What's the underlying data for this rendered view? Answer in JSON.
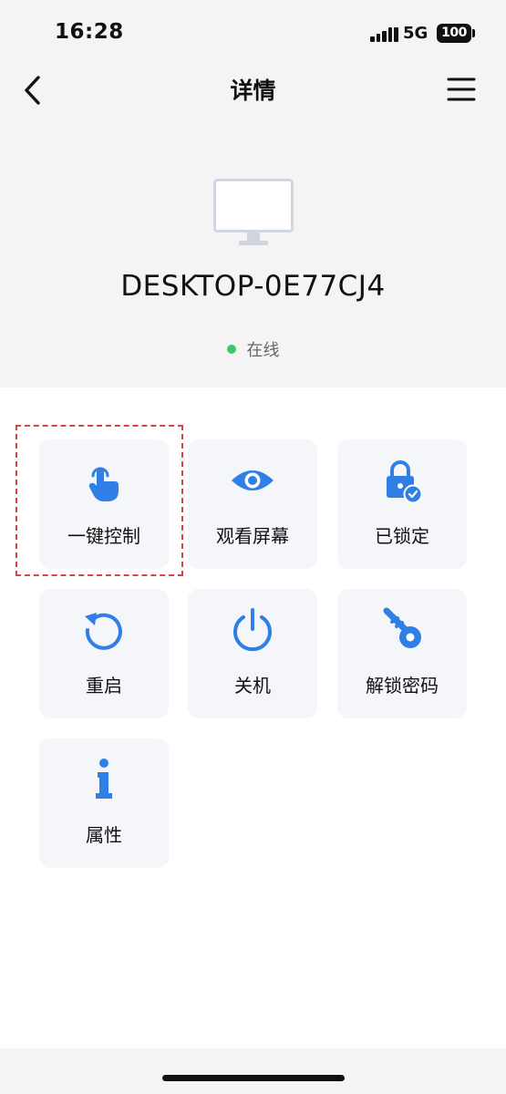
{
  "status_bar": {
    "time": "16:28",
    "network": "5G",
    "battery": "100"
  },
  "nav": {
    "title": "详情",
    "back_icon": "chevron-left-icon",
    "menu_icon": "hamburger-menu-icon"
  },
  "device": {
    "icon": "monitor-icon",
    "name": "DESKTOP-0E77CJ4",
    "status": "在线",
    "status_color": "#3ec76a"
  },
  "actions": [
    {
      "label": "一键控制",
      "icon": "touch-hand-icon"
    },
    {
      "label": "观看屏幕",
      "icon": "eye-icon"
    },
    {
      "label": "已锁定",
      "icon": "lock-check-icon"
    },
    {
      "label": "重启",
      "icon": "restart-icon"
    },
    {
      "label": "关机",
      "icon": "power-icon"
    },
    {
      "label": "解锁密码",
      "icon": "key-icon"
    },
    {
      "label": "属性",
      "icon": "info-icon"
    }
  ],
  "colors": {
    "accent": "#2f7fe6",
    "highlight": "#d64545",
    "header_bg": "#f4f4f5",
    "tile_bg": "#f4f6f9"
  }
}
